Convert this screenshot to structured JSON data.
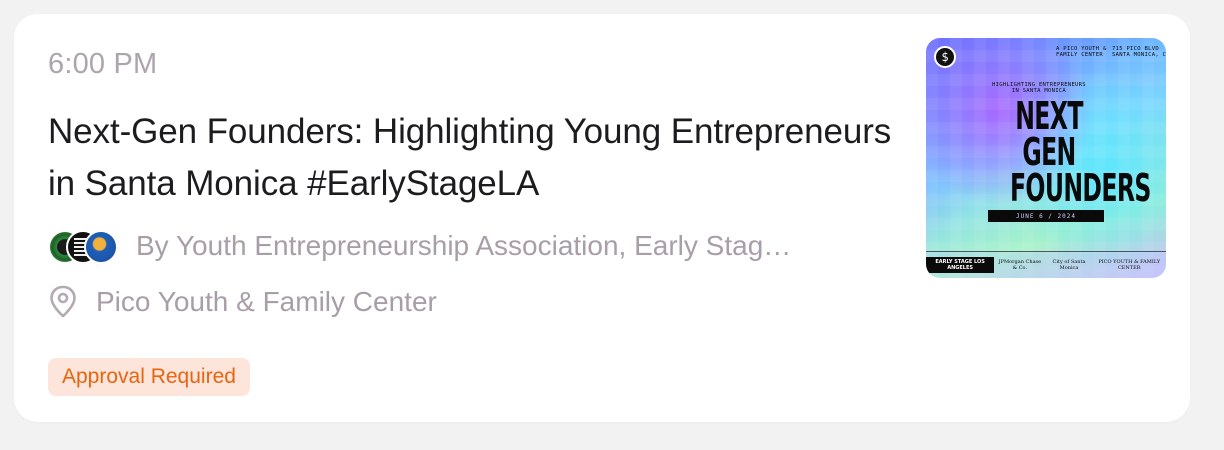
{
  "event": {
    "time": "6:00 PM",
    "title": "Next-Gen Founders: Highlighting Young Entrepreneurs in Santa Monica #EarlyStageLA",
    "hosts": "By Youth Entrepreneurship Association, Early Stag…",
    "location": "Pico Youth & Family Center",
    "badge": "Approval Required",
    "host_avatars": [
      "youth-entrepreneurship-association-avatar",
      "early-stage-avatar",
      "partner-logo-avatar"
    ],
    "location_icon": "map-pin-icon"
  },
  "poster": {
    "top_right_left": "A PICO YOUTH &\nFAMILY CENTER",
    "top_right_right": "715 PICO BLVD\nSANTA MONICA, CA",
    "subtitle": "HIGHLIGHTING ENTREPRENEURS\nIN SANTA MONICA",
    "headline": "NEXT GEN FOUNDERS",
    "date": "JUNE 6 / 2024",
    "sponsors": [
      "EARLY STAGE LOS ANGELES",
      "JPMorgan Chase & Co.",
      "City of Santa Monica",
      "PICO YOUTH & FAMILY CENTER"
    ]
  },
  "colors": {
    "badge_text": "#e8640f",
    "badge_bg": "#fde5db",
    "muted_text": "#a89ea8",
    "title_text": "#1c1c1e"
  }
}
